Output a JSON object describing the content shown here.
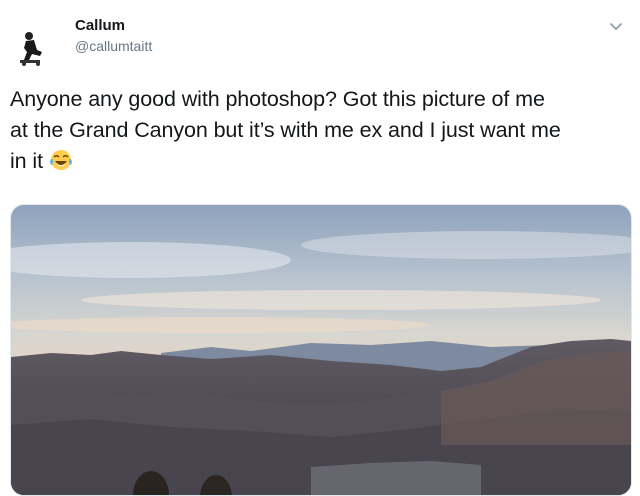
{
  "tweet": {
    "author_name": "Callum",
    "author_handle": "@callumtaitt",
    "text_lines": [
      "Anyone any good with photoshop? Got this picture of me",
      "at the Grand Canyon but it’s with me ex and I just want me",
      "in it"
    ],
    "emoji": "face-with-tears-of-joy",
    "media_alt": "photo-grand-canyon"
  },
  "icons": {
    "menu": "chevron-down-icon",
    "avatar": "avatar-silhouette"
  },
  "colors": {
    "text": "#14171a",
    "secondary": "#657786",
    "border": "#e1e8ed"
  }
}
